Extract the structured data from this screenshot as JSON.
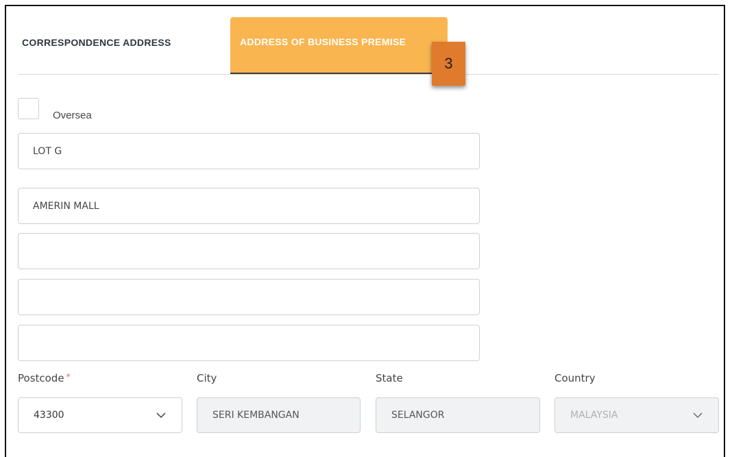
{
  "tabs": {
    "correspondence": "CORRESPONDENCE ADDRESS",
    "business": "ADDRESS OF BUSINESS PREMISE"
  },
  "badge": "3",
  "oversea": {
    "label": "Oversea",
    "checked": false
  },
  "address_lines": [
    "LOT G",
    "AMERIN MALL",
    "",
    "",
    ""
  ],
  "labels": {
    "postcode": "Postcode",
    "required_mark": "*",
    "city": "City",
    "state": "State",
    "country": "Country"
  },
  "values": {
    "postcode": "43300",
    "city": "SERI KEMBANGAN",
    "state": "SELANGOR",
    "country": "MALAYSIA"
  },
  "icons": {
    "postcode_dropdown": "chevron-down-icon",
    "country_dropdown": "chevron-down-icon"
  },
  "colors": {
    "active_tab": "#f9b54f",
    "badge": "#e07a2c",
    "required": "#e06a5e"
  }
}
